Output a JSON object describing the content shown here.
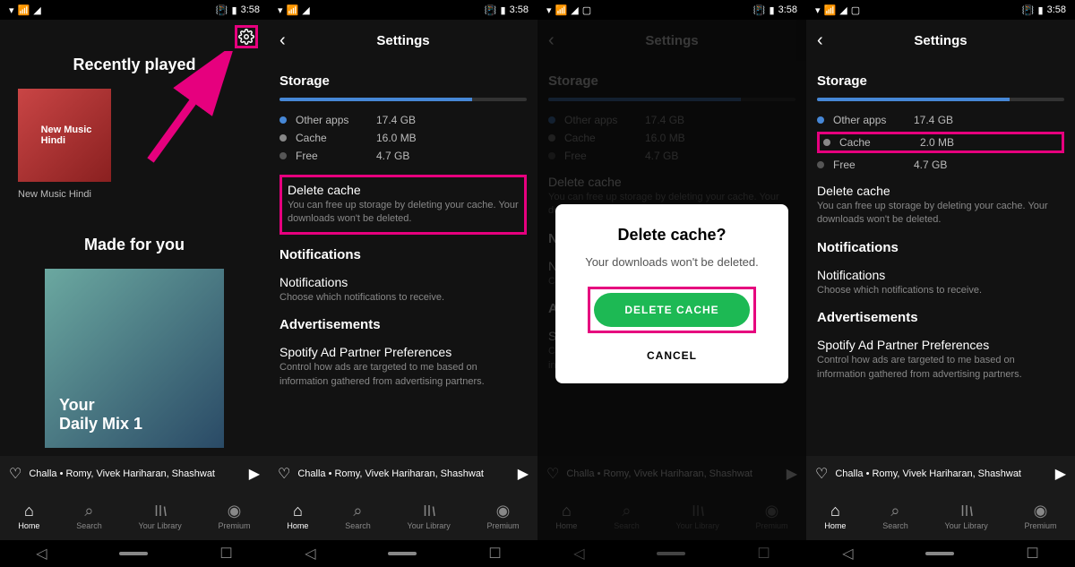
{
  "status": {
    "time": "3:58"
  },
  "home": {
    "recently_played": "Recently played",
    "album1": "New Music\nHindi",
    "album1_label": "New Music Hindi",
    "made_for_you": "Made for you",
    "daily_mix_your": "Your",
    "daily_mix": "Daily Mix 1"
  },
  "settings": {
    "title": "Settings",
    "storage": "Storage",
    "other_apps_label": "Other apps",
    "other_apps_value": "17.4 GB",
    "cache_label": "Cache",
    "cache_value": "16.0 MB",
    "cache_value_after": "2.0 MB",
    "free_label": "Free",
    "free_value": "4.7 GB",
    "delete_cache_title": "Delete cache",
    "delete_cache_desc": "You can free up storage by deleting your cache. Your downloads won't be deleted.",
    "notifications_section": "Notifications",
    "notifications_title": "Notifications",
    "notifications_desc": "Choose which notifications to receive.",
    "ads_section": "Advertisements",
    "ads_title": "Spotify Ad Partner Preferences",
    "ads_desc": "Control how ads are targeted to me based on information gathered from advertising partners."
  },
  "modal": {
    "title": "Delete cache?",
    "desc": "Your downloads won't be deleted.",
    "confirm": "DELETE CACHE",
    "cancel": "CANCEL"
  },
  "now_playing": "Challa • Romy, Vivek Hariharan, Shashwat",
  "nav": {
    "home": "Home",
    "search": "Search",
    "library": "Your Library",
    "premium": "Premium"
  }
}
